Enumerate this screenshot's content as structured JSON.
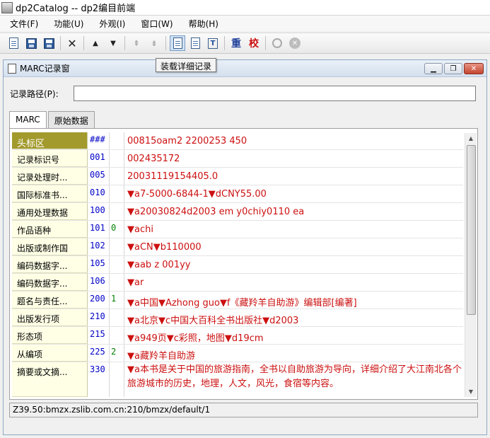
{
  "window": {
    "title": "dp2Catalog -- dp2编目前端"
  },
  "menu": [
    "文件(F)",
    "功能(U)",
    "外观(I)",
    "窗口(W)",
    "帮助(H)"
  ],
  "toolbar": {
    "tooltip": "装载详细记录",
    "verify_label": "校",
    "redo_label": "重"
  },
  "child": {
    "title": "MARC记录窗",
    "path_label": "记录路径(P):",
    "path_value": ""
  },
  "tabs": [
    "MARC",
    "原始数据"
  ],
  "fields": [
    {
      "name": "头标区",
      "tag": "###",
      "ind": "",
      "content": "00815oam2 2200253   450"
    },
    {
      "name": "记录标识号",
      "tag": "001",
      "ind": "",
      "content": "002435172"
    },
    {
      "name": "记录处理时...",
      "tag": "005",
      "ind": "",
      "content": "20031119154405.0"
    },
    {
      "name": "国际标准书...",
      "tag": "010",
      "ind": "",
      "content": "▼a7-5000-6844-1▼dCNY55.00"
    },
    {
      "name": "通用处理数据",
      "tag": "100",
      "ind": "",
      "content": "▼a20030824d2003    em y0chiy0110    ea"
    },
    {
      "name": "作品语种",
      "tag": "101",
      "ind": "0",
      "content": "▼achi"
    },
    {
      "name": "出版或制作国",
      "tag": "102",
      "ind": "",
      "content": "▼aCN▼b110000"
    },
    {
      "name": "编码数据字...",
      "tag": "105",
      "ind": "",
      "content": "▼aab  z   001yy"
    },
    {
      "name": "编码数据字...",
      "tag": "106",
      "ind": "",
      "content": "▼ar"
    },
    {
      "name": "题名与责任...",
      "tag": "200",
      "ind": "1",
      "content": "▼a中国▼Azhong guo▼f《藏羚羊自助游》编辑部[编著]"
    },
    {
      "name": "出版发行项",
      "tag": "210",
      "ind": "",
      "content": "▼a北京▼c中国大百科全书出版社▼d2003"
    },
    {
      "name": "形态项",
      "tag": "215",
      "ind": "",
      "content": "▼a949页▼c彩照，地图▼d19cm"
    },
    {
      "name": "从编项",
      "tag": "225",
      "ind": "2",
      "content": "▼a藏羚羊自助游"
    },
    {
      "name": "摘要或文摘...",
      "tag": "330",
      "ind": "",
      "content": "▼a本书是关于中国的旅游指南，全书以自助旅游为导向，详细介绍了大江南北各个旅游城市的历史，地理，人文，风光，食宿等内容。"
    }
  ],
  "status": {
    "server": "Z39.50:bmzx.zslib.com.cn:210/bmzx/default/1"
  }
}
